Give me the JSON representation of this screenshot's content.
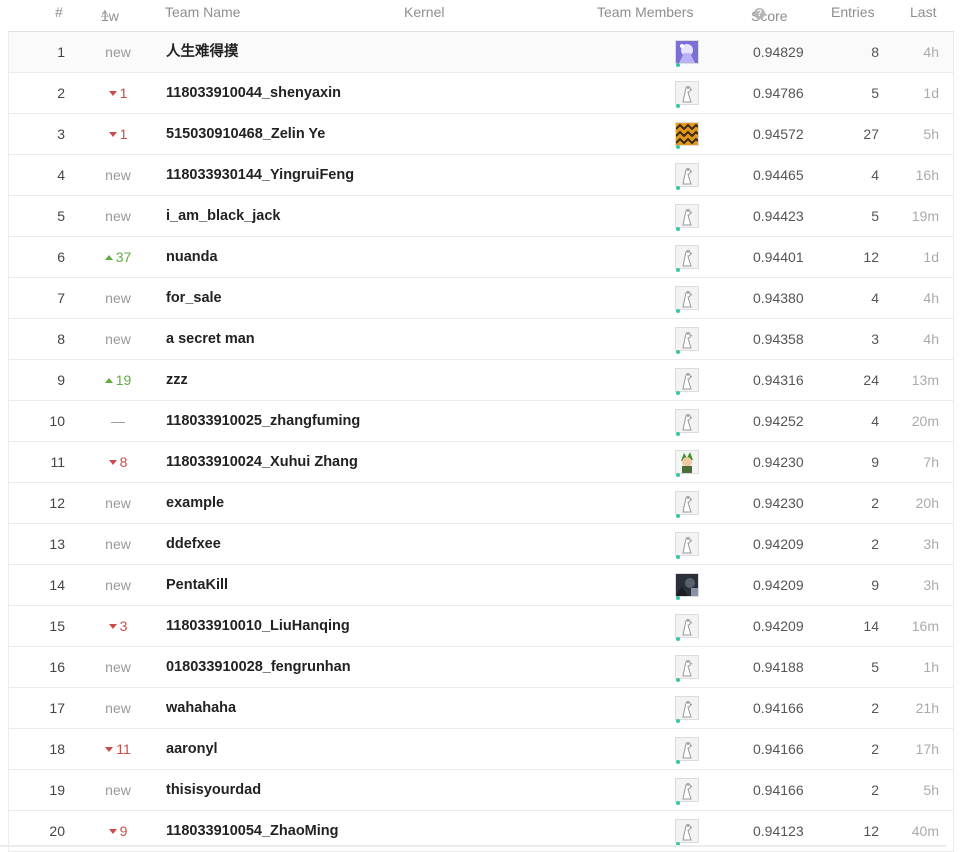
{
  "header": {
    "rank": "#",
    "delta_icon": "△",
    "delta": "1w",
    "team_name": "Team Name",
    "kernel": "Kernel",
    "team_members": "Team Members",
    "score": "Score",
    "score_info_icon": "?",
    "entries": "Entries",
    "last": "Last"
  },
  "rows": [
    {
      "rank": "1",
      "delta": "new",
      "dir": "none",
      "team": "人生难得摸",
      "avatar": "anime-blue",
      "score": "0.94829",
      "entries": "8",
      "last": "4h"
    },
    {
      "rank": "2",
      "delta": "1",
      "dir": "down",
      "team": "118033910044_shenyaxin",
      "avatar": "default",
      "score": "0.94786",
      "entries": "5",
      "last": "1d"
    },
    {
      "rank": "3",
      "delta": "1",
      "dir": "down",
      "team": "515030910468_Zelin Ye",
      "avatar": "pattern-orange",
      "score": "0.94572",
      "entries": "27",
      "last": "5h"
    },
    {
      "rank": "4",
      "delta": "new",
      "dir": "none",
      "team": "118033930144_YingruiFeng",
      "avatar": "default",
      "score": "0.94465",
      "entries": "4",
      "last": "16h"
    },
    {
      "rank": "5",
      "delta": "new",
      "dir": "none",
      "team": "i_am_black_jack",
      "avatar": "default",
      "score": "0.94423",
      "entries": "5",
      "last": "19m"
    },
    {
      "rank": "6",
      "delta": "37",
      "dir": "up",
      "team": "nuanda",
      "avatar": "default",
      "score": "0.94401",
      "entries": "12",
      "last": "1d"
    },
    {
      "rank": "7",
      "delta": "new",
      "dir": "none",
      "team": "for_sale",
      "avatar": "default",
      "score": "0.94380",
      "entries": "4",
      "last": "4h"
    },
    {
      "rank": "8",
      "delta": "new",
      "dir": "none",
      "team": "a secret man",
      "avatar": "default",
      "score": "0.94358",
      "entries": "3",
      "last": "4h"
    },
    {
      "rank": "9",
      "delta": "19",
      "dir": "up",
      "team": "zzz",
      "avatar": "default",
      "score": "0.94316",
      "entries": "24",
      "last": "13m"
    },
    {
      "rank": "10",
      "delta": "—",
      "dir": "none",
      "team": "118033910025_zhangfuming",
      "avatar": "default",
      "score": "0.94252",
      "entries": "4",
      "last": "20m"
    },
    {
      "rank": "11",
      "delta": "8",
      "dir": "down",
      "team": "118033910024_Xuhui Zhang",
      "avatar": "anime-green",
      "score": "0.94230",
      "entries": "9",
      "last": "7h"
    },
    {
      "rank": "12",
      "delta": "new",
      "dir": "none",
      "team": "example",
      "avatar": "default",
      "score": "0.94230",
      "entries": "2",
      "last": "20h"
    },
    {
      "rank": "13",
      "delta": "new",
      "dir": "none",
      "team": "ddefxee",
      "avatar": "default",
      "score": "0.94209",
      "entries": "2",
      "last": "3h"
    },
    {
      "rank": "14",
      "delta": "new",
      "dir": "none",
      "team": "PentaKill",
      "avatar": "dark-photo",
      "score": "0.94209",
      "entries": "9",
      "last": "3h"
    },
    {
      "rank": "15",
      "delta": "3",
      "dir": "down",
      "team": "118033910010_LiuHanqing",
      "avatar": "default",
      "score": "0.94209",
      "entries": "14",
      "last": "16m"
    },
    {
      "rank": "16",
      "delta": "new",
      "dir": "none",
      "team": "018033910028_fengrunhan",
      "avatar": "default",
      "score": "0.94188",
      "entries": "5",
      "last": "1h"
    },
    {
      "rank": "17",
      "delta": "new",
      "dir": "none",
      "team": "wahahaha",
      "avatar": "default",
      "score": "0.94166",
      "entries": "2",
      "last": "21h"
    },
    {
      "rank": "18",
      "delta": "11",
      "dir": "down",
      "team": "aaronyl",
      "avatar": "default",
      "score": "0.94166",
      "entries": "2",
      "last": "17h"
    },
    {
      "rank": "19",
      "delta": "new",
      "dir": "none",
      "team": "thisisyourdad",
      "avatar": "default",
      "score": "0.94166",
      "entries": "2",
      "last": "5h"
    },
    {
      "rank": "20",
      "delta": "9",
      "dir": "down",
      "team": "118033910054_ZhaoMing",
      "avatar": "default",
      "score": "0.94123",
      "entries": "12",
      "last": "40m"
    }
  ],
  "colors": {
    "up": "#5fad3c",
    "down": "#cc4b4b",
    "online_dot": "#3cc3a7"
  }
}
